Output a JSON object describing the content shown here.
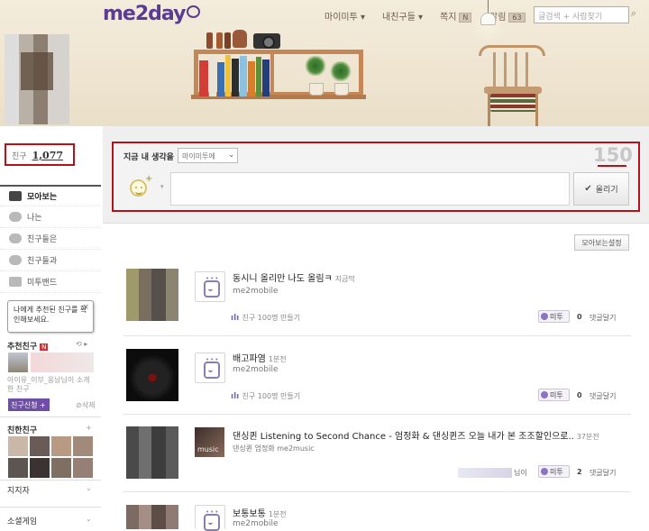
{
  "header": {
    "logo": "me2day",
    "nav": {
      "my_metoo": "마이미투 ▾",
      "my_friends": "내친구들 ▾",
      "notes": "쪽지",
      "notes_badge": "N",
      "alarms": "알림",
      "alarms_badge": "63"
    },
    "search_placeholder": "글검색 + 사람찾기"
  },
  "profile": {
    "friend_label": "친구",
    "friend_count": "1,077"
  },
  "sidebar": {
    "items": [
      {
        "label": "모아보는"
      },
      {
        "label": "나는"
      },
      {
        "label": "친구들은"
      },
      {
        "label": "친구들과"
      },
      {
        "label": "미투밴드"
      }
    ],
    "tooltip": {
      "text": "나에게 추천된 친구를 확인해보세요.",
      "close": "×"
    },
    "recommended": {
      "title": "추천친구",
      "badge": "N",
      "desc": "아이유_이부_옹남님이 소개한 친구",
      "add_button": "친구신청 +",
      "delete": "삭제"
    },
    "close_friends": {
      "title": "친한친구",
      "more": "+"
    },
    "bottom_items": [
      {
        "label": "지지자"
      },
      {
        "label": "소셜게임"
      }
    ]
  },
  "compose": {
    "label": "지금 내 생각을",
    "select_value": "마이미투에",
    "counter": "150",
    "post_button": "올리기"
  },
  "feed": {
    "settings_button": "모아보는설정",
    "posts": [
      {
        "title": "동시니 올리만 나도 올림ㅋ",
        "time": "지금막",
        "author": "me2mobile",
        "campaign": "친구 100명 만들기",
        "metoo_label": "미투",
        "metoo_count": "0",
        "comment_label": "댓글달기"
      },
      {
        "title": "배고파염",
        "time": "1분전",
        "author": "me2mobile",
        "campaign": "친구 100명 만들기",
        "metoo_label": "미투",
        "metoo_count": "0",
        "comment_label": "댓글달기"
      },
      {
        "title": "댄싱퀸 Listening to Second Chance - 엄정화 & 댄싱퀸즈 오늘 내가 본 조조할인으로..",
        "time": "37분전",
        "author": "댄싱퀸 엄정화 me2music",
        "suffix": "님이",
        "metoo_label": "미투",
        "metoo_count": "2",
        "comment_label": "댓글달기"
      },
      {
        "title": "보통보통",
        "time": "1분전",
        "author": "me2mobile"
      }
    ]
  },
  "colors": {
    "brand": "#5b3c93",
    "highlight": "#b3121a"
  }
}
